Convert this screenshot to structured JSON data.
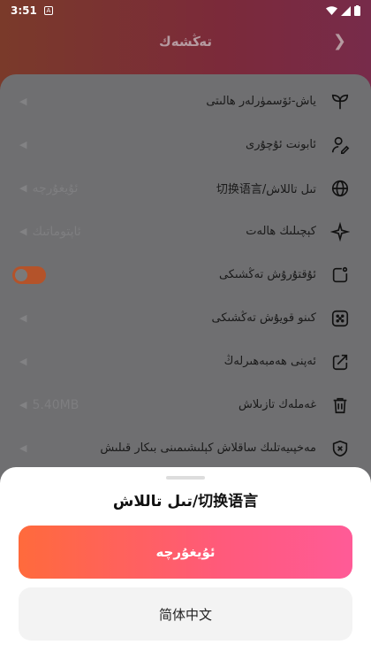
{
  "statusbar": {
    "time": "3:51",
    "sim_glyph": "A"
  },
  "header": {
    "title": "تەڭشەك",
    "back_icon": "chevron-right-icon"
  },
  "settings": [
    {
      "label": "ياش-ئۆسمۈرلەر ھالىتى",
      "value": "",
      "icon": "sprout-icon",
      "control": "chevron"
    },
    {
      "label": "ئابونت ئۇچۇرى",
      "value": "",
      "icon": "user-edit-icon",
      "control": "chevron"
    },
    {
      "label": "تىل تاللاش/切换语言",
      "value": "ئۇيغۇرچە",
      "icon": "globe-icon",
      "control": "chevron"
    },
    {
      "label": "كېچىلىك ھالەت",
      "value": "ئاپتوماتىك",
      "icon": "sparkle-icon",
      "control": "chevron"
    },
    {
      "label": "ئۇقتۇرۇش تەڭشىكى",
      "value": "",
      "icon": "notification-icon",
      "control": "toggle"
    },
    {
      "label": "كىنو قويۇش تەڭشىكى",
      "value": "",
      "icon": "dice-icon",
      "control": "chevron"
    },
    {
      "label": "ئەپنى ھەمبەھىرلەڭ",
      "value": "",
      "icon": "share-icon",
      "control": "chevron"
    },
    {
      "label": "غەملەك تازىلاش",
      "value": "5.40MB",
      "icon": "trash-icon",
      "control": "chevron"
    },
    {
      "label": "مەخپىيەتلىك ساقلاش كېلىشىمىنى بىكار قىلىش",
      "value": "",
      "icon": "shield-x-icon",
      "control": "chevron"
    }
  ],
  "sheet": {
    "title": "تىل تاللاش/切换语言",
    "options": [
      {
        "label": "ئۇيغۇرچە",
        "selected": true
      },
      {
        "label": "简体中文",
        "selected": false
      }
    ]
  },
  "colors": {
    "accent_start": "#ff6a3c",
    "accent_end": "#ff5b97"
  }
}
